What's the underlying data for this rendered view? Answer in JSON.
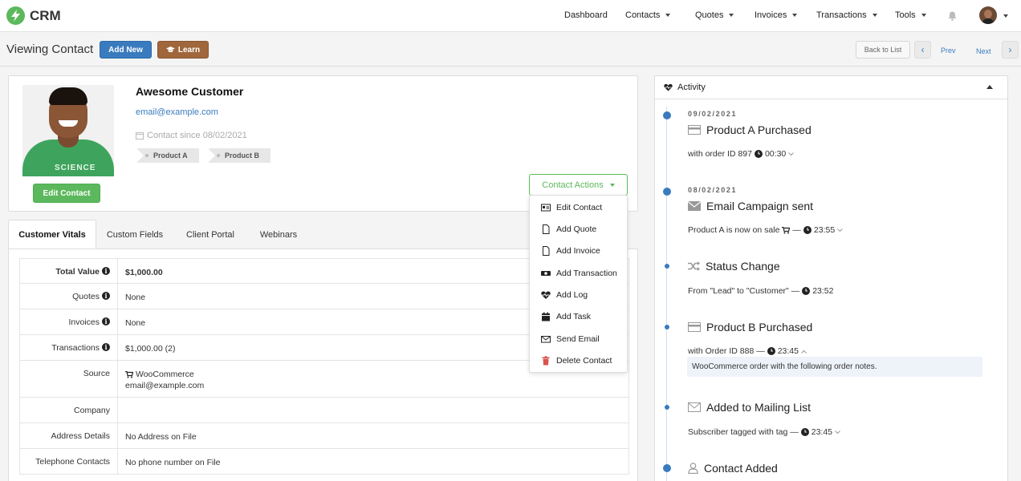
{
  "app": {
    "name": "CRM"
  },
  "nav": {
    "dashboard": "Dashboard",
    "contacts": "Contacts",
    "quotes": "Quotes",
    "invoices": "Invoices",
    "transactions": "Transactions",
    "tools": "Tools"
  },
  "subheader": {
    "title": "Viewing Contact",
    "add_new": "Add New",
    "learn": "Learn",
    "back_to_list": "Back to List",
    "prev": "Prev",
    "next": "Next"
  },
  "contact": {
    "name": "Awesome Customer",
    "email": "email@example.com",
    "since": "Contact since 08/02/2021",
    "tags": [
      "Product A",
      "Product B"
    ],
    "edit_button": "Edit Contact",
    "photo_shirt_text": "SCIENCE",
    "actions_button": "Contact Actions"
  },
  "actions_menu": {
    "items": [
      {
        "label": "Edit Contact",
        "icon": "id-card-icon"
      },
      {
        "label": "Add Quote",
        "icon": "file-icon"
      },
      {
        "label": "Add Invoice",
        "icon": "file-icon"
      },
      {
        "label": "Add Transaction",
        "icon": "money-icon"
      },
      {
        "label": "Add Log",
        "icon": "heartbeat-icon"
      },
      {
        "label": "Add Task",
        "icon": "calendar-icon"
      },
      {
        "label": "Send Email",
        "icon": "envelope-icon"
      },
      {
        "label": "Delete Contact",
        "icon": "trash-icon"
      }
    ],
    "danger_color": "#d9534f"
  },
  "tabs": [
    "Customer Vitals",
    "Custom Fields",
    "Client Portal",
    "Webinars"
  ],
  "vitals": {
    "rows": [
      {
        "label": "Total Value",
        "value": "$1,000.00",
        "info": true
      },
      {
        "label": "Quotes",
        "value": "None",
        "info": true
      },
      {
        "label": "Invoices",
        "value": "None",
        "info": true
      },
      {
        "label": "Transactions",
        "value": "$1,000.00 (2)",
        "info": true
      },
      {
        "label": "Source",
        "value": "WooCommerce",
        "value2": "email@example.com",
        "info": false
      },
      {
        "label": "Company",
        "value": "",
        "info": false
      },
      {
        "label": "Address Details",
        "value": "No Address on File",
        "info": false
      },
      {
        "label": "Telephone Contacts",
        "value": "No phone number on File",
        "info": false
      }
    ]
  },
  "activity": {
    "title": "Activity",
    "events": [
      {
        "date": "09/02/2021",
        "title": "Product A Purchased",
        "sub": "with order ID 897",
        "time": "00:30",
        "icon": "credit-card-icon"
      },
      {
        "date": "08/02/2021",
        "title": "Email Campaign sent",
        "sub": "Product A is now on sale",
        "time": "23:55",
        "icon": "envelope-icon"
      },
      {
        "date": "",
        "title": "Status Change",
        "sub": "From \"Lead\" to \"Customer\" —",
        "time": "23:52",
        "icon": "random-icon"
      },
      {
        "date": "",
        "title": "Product B Purchased",
        "sub": "with Order ID 888 —",
        "time": "23:45",
        "icon": "credit-card-icon",
        "note": "WooCommerce order with the following order notes."
      },
      {
        "date": "",
        "title": "Added to Mailing List",
        "sub": "Subscriber tagged with tag —",
        "time": "23:45",
        "icon": "envelope-icon"
      },
      {
        "date": "",
        "title": "Contact Added",
        "sub": "",
        "time": "",
        "icon": "user-icon"
      }
    ]
  },
  "colors": {
    "accent": "#3a7bbf",
    "success": "#5cb85c",
    "learn": "#a0673c"
  }
}
